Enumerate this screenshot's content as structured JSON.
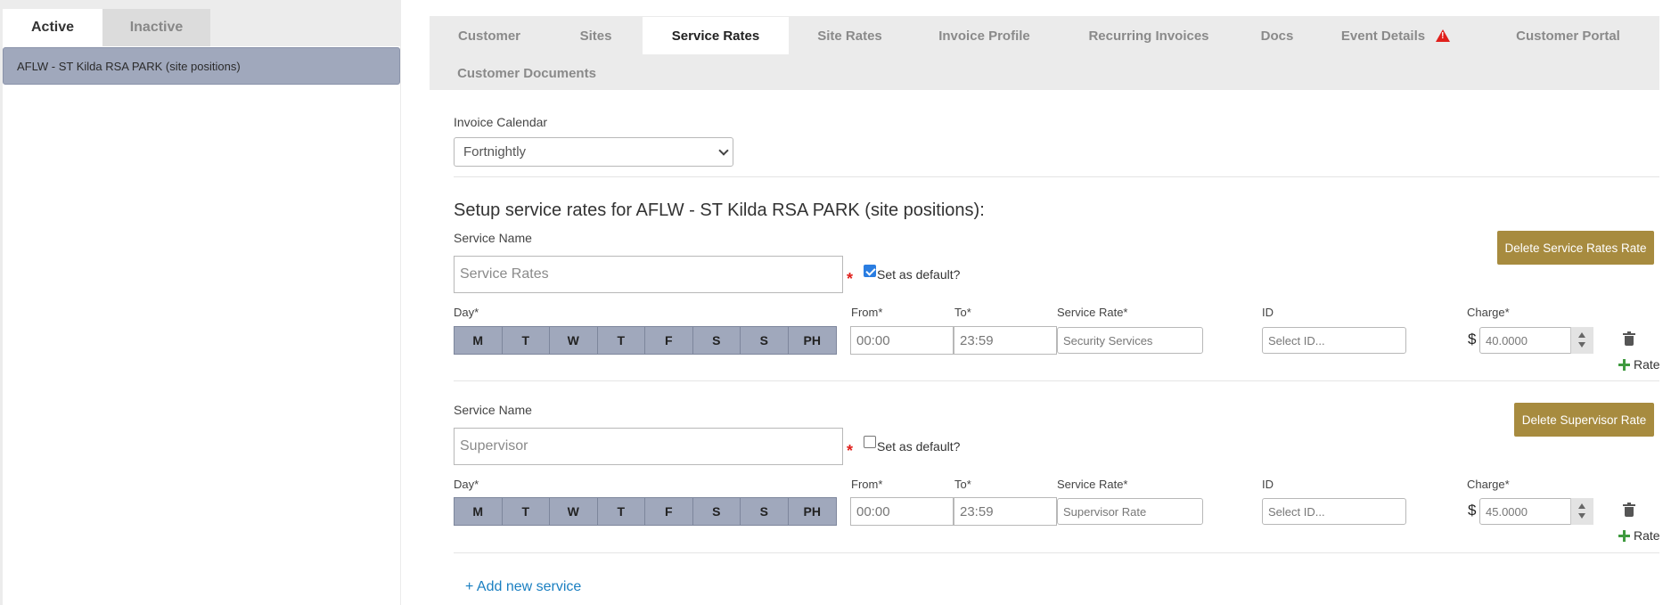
{
  "left_panel": {
    "tabs": {
      "active": "Active",
      "inactive": "Inactive"
    },
    "sites": [
      "AFLW - ST Kilda RSA PARK (site positions)"
    ]
  },
  "tabs": [
    "Customer",
    "Sites",
    "Service Rates",
    "Site Rates",
    "Invoice Profile",
    "Recurring Invoices",
    "Docs",
    "Event Details",
    "Customer Portal",
    "Customer Documents"
  ],
  "active_tab": "Service Rates",
  "event_details_icon": "warning-triangle-icon",
  "invoice_calendar": {
    "label": "Invoice Calendar",
    "value": "Fortnightly"
  },
  "heading": "Setup service rates for AFLW - ST Kilda RSA PARK (site positions):",
  "days": [
    "M",
    "T",
    "W",
    "T",
    "F",
    "S",
    "S",
    "PH"
  ],
  "labels": {
    "service_name": "Service Name",
    "set_default": "Set as default?",
    "day": "Day*",
    "from": "From*",
    "to": "To*",
    "service_rate": "Service Rate*",
    "id": "ID",
    "charge": "Charge*",
    "rate": "Rate",
    "currency": "$",
    "required_mark": "*"
  },
  "services": [
    {
      "name": "Service Rates",
      "is_default": true,
      "delete_label": "Delete Service Rates Rate",
      "from": "00:00",
      "to": "23:59",
      "service_rate": "Security Services",
      "id_placeholder": "Select ID...",
      "charge": "40.0000"
    },
    {
      "name": "Supervisor",
      "is_default": false,
      "delete_label": "Delete Supervisor Rate",
      "from": "00:00",
      "to": "23:59",
      "service_rate": "Supervisor Rate",
      "id_placeholder": "Select ID...",
      "charge": "45.0000"
    }
  ],
  "add_service_label": "+ Add new service",
  "colors": {
    "accent_gold": "#a78b3f",
    "day_chip": "#a0a8bc",
    "link_blue": "#1a7fc1",
    "required_red": "#e0201c"
  }
}
